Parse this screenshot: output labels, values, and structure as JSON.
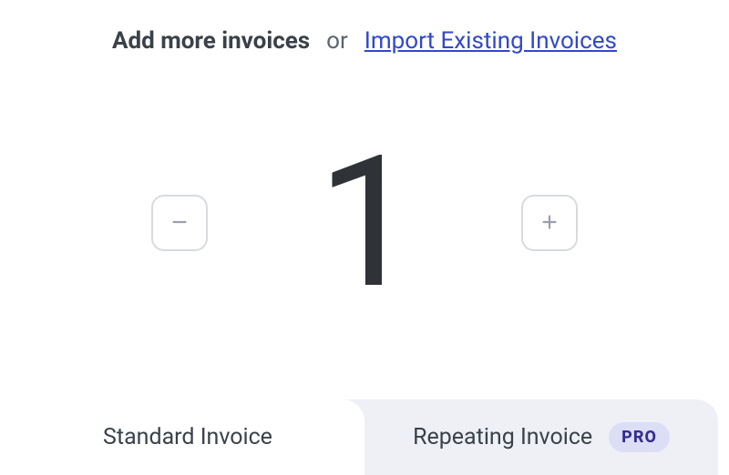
{
  "header": {
    "title": "Add more invoices",
    "or": "or",
    "link": "Import Existing Invoices"
  },
  "stepper": {
    "value": "1"
  },
  "tabs": {
    "standard": "Standard Invoice",
    "repeating": "Repeating Invoice",
    "badge": "PRO"
  }
}
